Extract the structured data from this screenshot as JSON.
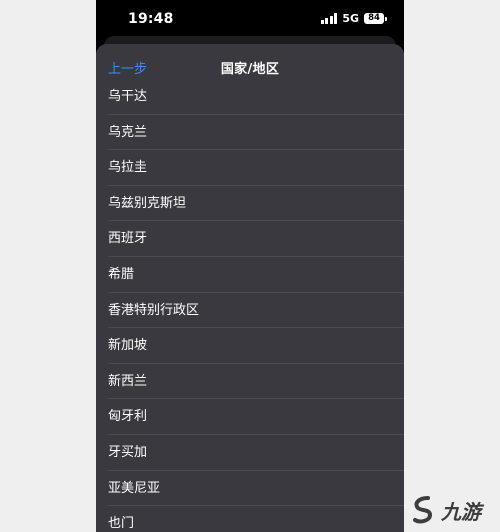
{
  "status_bar": {
    "time": "19:48",
    "network": "5G",
    "battery": "84"
  },
  "nav": {
    "back_label": "上一步",
    "title": "国家/地区"
  },
  "countries": [
    "乌干达",
    "乌克兰",
    "乌拉圭",
    "乌兹别克斯坦",
    "西班牙",
    "希腊",
    "香港特别行政区",
    "新加坡",
    "新西兰",
    "匈牙利",
    "牙买加",
    "亚美尼亚",
    "也门"
  ],
  "watermark": {
    "text": "九游"
  },
  "colors": {
    "accent": "#3a8ef6",
    "sheet": "#39393f",
    "separator": "#4b4b52",
    "page_background": "#efeff0"
  }
}
